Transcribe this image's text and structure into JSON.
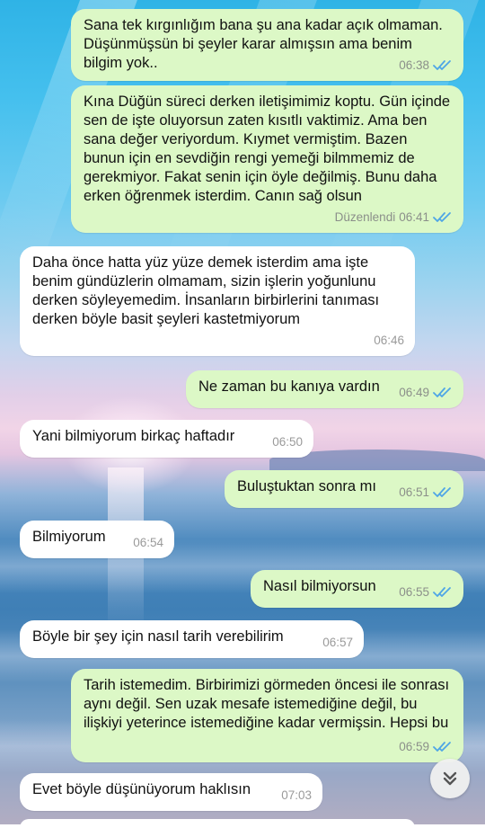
{
  "messages": [
    {
      "dir": "out",
      "text": "Sana tek kırgınlığım bana şu ana kadar açık olmaman. Düşünmüşsün bi şeyler karar almışsın ama benim bilgim yok..",
      "time": "06:38",
      "read": true
    },
    {
      "dir": "out",
      "text": "Kına Düğün süreci derken iletişimimiz koptu. Gün içinde sen de işte oluyorsun zaten kısıtlı vaktimiz. Ama ben sana değer veriyordum. Kıymet vermiştim. Bazen bunun için en sevdiğin rengi yemeği bilmmemiz de gerekmiyor. Fakat senin için öyle değilmiş. Bunu daha erken öğrenmek isterdim. Canın sağ olsun",
      "time": "06:41",
      "edited_label": "Düzenlendi",
      "read": true
    },
    {
      "dir": "in",
      "text": "Daha önce hatta yüz yüze demek isterdim ama işte benim gündüzlerin olmamam, sizin işlerin yoğunlunu derken söyleyemedim. İnsanların birbirlerini tanıması derken böyle basit şeyleri kastetmiyorum",
      "time": "06:46"
    },
    {
      "dir": "out",
      "text": "Ne zaman bu kanıya vardın",
      "time": "06:49",
      "read": true
    },
    {
      "dir": "in",
      "text": "Yani bilmiyorum birkaç haftadır",
      "time": "06:50"
    },
    {
      "dir": "out",
      "text": "Buluştuktan sonra mı",
      "time": "06:51",
      "read": true
    },
    {
      "dir": "in",
      "text": "Bilmiyorum",
      "time": "06:54"
    },
    {
      "dir": "out",
      "text": "Nasıl bilmiyorsun",
      "time": "06:55",
      "read": true
    },
    {
      "dir": "in",
      "text": "Böyle bir şey için nasıl tarih verebilirim",
      "time": "06:57"
    },
    {
      "dir": "out",
      "text": "Tarih istemedim. Birbirimizi görmeden öncesi ile sonrası aynı değil. Sen uzak mesafe istemediğine değil, bu ilişkiyi yeterince istemediğine kadar vermişsin. Hepsi bu",
      "time": "06:59",
      "read": true
    },
    {
      "dir": "in",
      "text": "Evet böyle düşünüyorum haklısın",
      "time": "07:03"
    }
  ],
  "colors": {
    "outgoing": "#dcf8c6",
    "incoming": "#ffffff",
    "read_ticks": "#4fa6e6"
  },
  "icons": {
    "scroll_down": "double-chevron-down-icon",
    "read_receipt": "double-check-icon"
  }
}
